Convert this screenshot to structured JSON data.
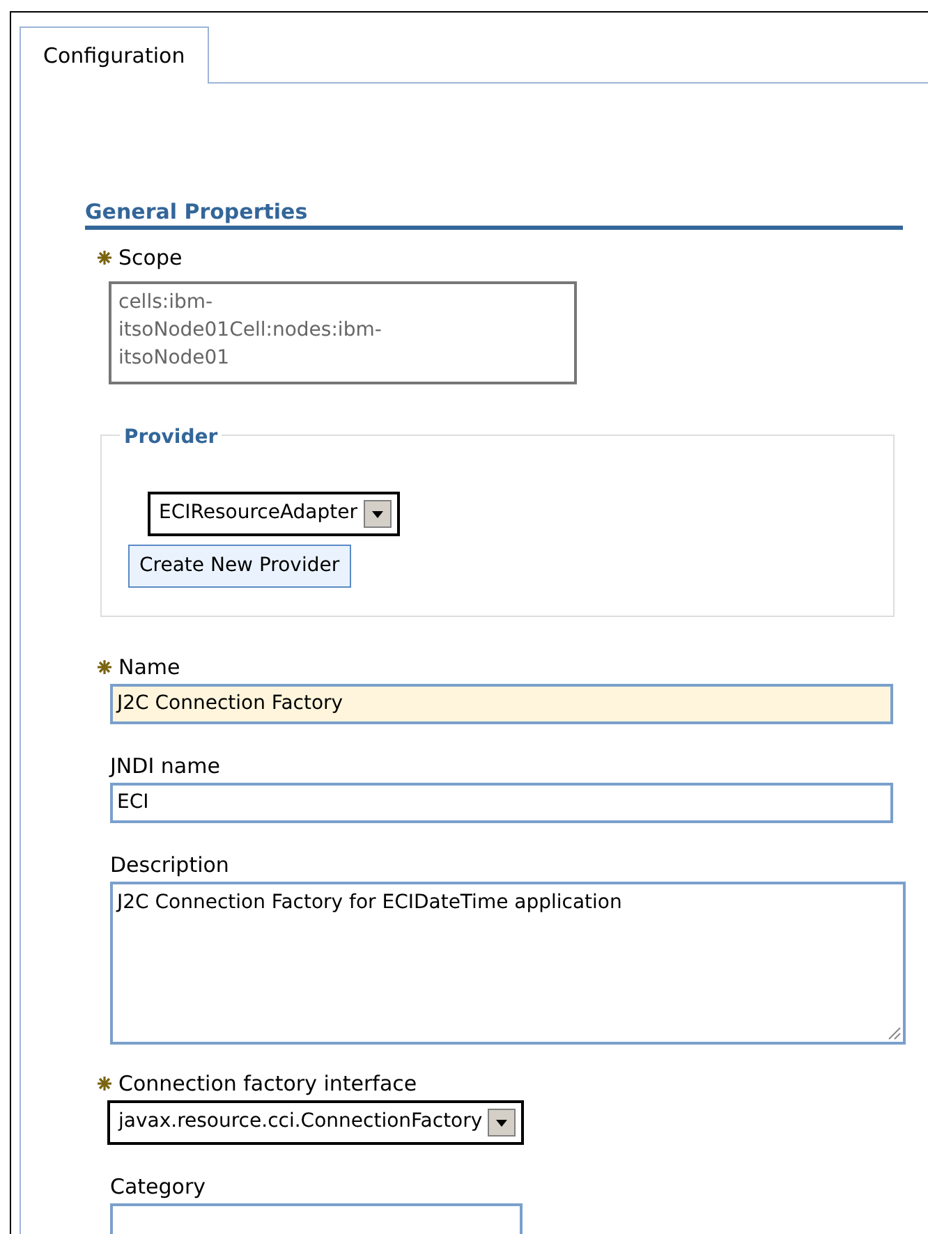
{
  "tabs": [
    {
      "label": "Configuration",
      "selected": true
    }
  ],
  "section": {
    "title": "General Properties"
  },
  "scope": {
    "label": "Scope",
    "required": true,
    "value": [
      "cells:ibm-",
      "itsoNode01Cell:nodes:ibm-",
      "itsoNode01"
    ]
  },
  "provider": {
    "legend": "Provider",
    "select": {
      "value": "ECIResourceAdapter"
    },
    "button": "Create New Provider"
  },
  "fields": [
    {
      "kind": "text",
      "label": "Name",
      "required": true,
      "value": "J2C Connection Factory",
      "highlighted": true
    },
    {
      "kind": "text",
      "label": "JNDI name",
      "required": false,
      "value": "ECI"
    },
    {
      "kind": "textarea",
      "label": "Description",
      "required": false,
      "value": "J2C Connection Factory for ECIDateTime application"
    },
    {
      "kind": "select",
      "label": "Connection factory interface",
      "required": true,
      "value": "javax.resource.cci.ConnectionFactory"
    },
    {
      "kind": "short",
      "label": "Category",
      "required": false
    }
  ]
}
